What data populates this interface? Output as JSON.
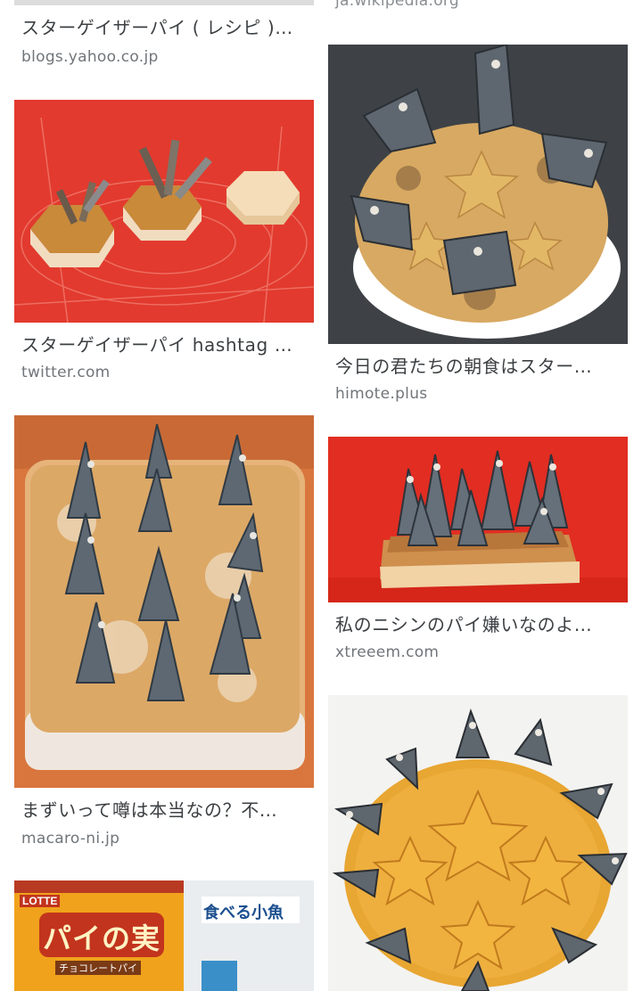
{
  "results": {
    "top_left": {
      "caption": "スターゲイザーパイ ( レシピ )…",
      "source": "blogs.yahoo.co.jp"
    },
    "top_right": {
      "source": "ja.wikipedia.org"
    },
    "left": [
      {
        "caption": "スターゲイザーパイ hashtag …",
        "source": "twitter.com",
        "image": "red-mat-mini-pies-image"
      },
      {
        "caption": "まずいって噂は本当なの？不…",
        "source": "macaro-ni.jp",
        "image": "rectangular-fish-pie-image"
      },
      {
        "image": "snack-packages-image",
        "package_texts": [
          "LOTTE",
          "パイの実",
          "チョコレートパイ",
          "食べる小魚"
        ]
      }
    ],
    "right": [
      {
        "caption": "今日の君たちの朝食はスター…",
        "source": "himote.plus",
        "image": "round-fish-pie-plate-image"
      },
      {
        "caption": "私のニシンのパイ嫌いなのよ…",
        "source": "xtreeem.com",
        "image": "square-fish-pie-red-image"
      },
      {
        "image": "golden-star-pie-image"
      }
    ]
  },
  "colors": {
    "caption": "#3c4043",
    "source": "#70757a",
    "red_bg": "#e0352b",
    "crust": "#d9a45a",
    "pie_gold": "#e8a632",
    "fish": "#5f6770"
  }
}
